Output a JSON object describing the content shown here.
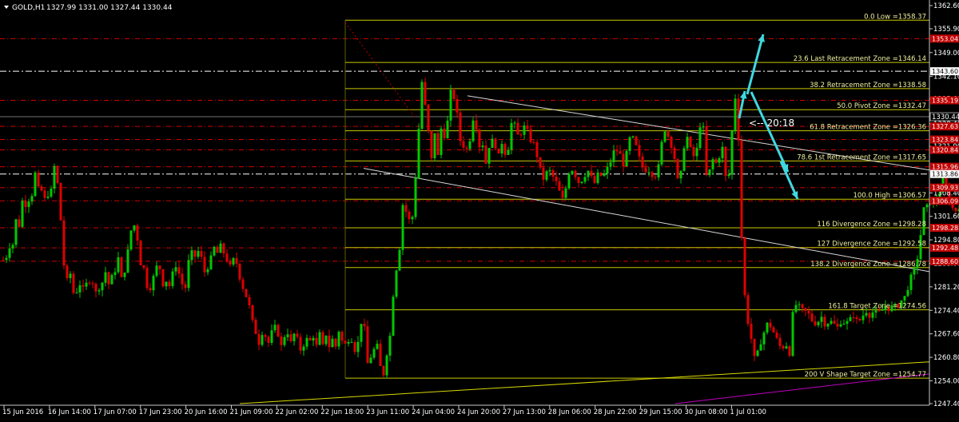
{
  "header": {
    "symbol": "GOLD,H1",
    "ohlc": "1327.99 1331.00 1327.44 1330.44"
  },
  "colors": {
    "background": "#000000",
    "bull": "#00c800",
    "bear": "#e00000",
    "fib": "#c8c800",
    "level": "#d00000",
    "trend": "#d8d8d8",
    "arrow": "#40d8e0",
    "support": "#d8d800",
    "magenta": "#c000c0"
  },
  "chart_data": {
    "type": "candlestick",
    "title": "GOLD,H1",
    "ylim": [
      1247.4,
      1362.6
    ],
    "y_ticks": [
      "1362.60",
      "1355.90",
      "1349.00",
      "1342.10",
      "1335.60",
      "1328.40",
      "1321.90",
      "1315.10",
      "1308.40",
      "1301.60",
      "1294.80",
      "1288.00",
      "1281.20",
      "1274.40",
      "1267.60",
      "1260.80",
      "1254.00",
      "1247.40"
    ],
    "x_ticks": [
      "15 Jun 2016",
      "16 Jun 14:00",
      "17 Jun 07:00",
      "17 Jun 23:00",
      "20 Jun 16:00",
      "21 Jun 09:00",
      "22 Jun 02:00",
      "22 Jun 18:00",
      "23 Jun 11:00",
      "24 Jun 04:00",
      "24 Jun 20:00",
      "27 Jun 13:00",
      "28 Jun 06:00",
      "28 Jun 22:00",
      "29 Jun 15:00",
      "30 Jun 08:00",
      "1 Jul 01:00"
    ],
    "current_price": "1330.44",
    "current_price_value": 1330.44,
    "white_levels": [
      {
        "label": "1343.60",
        "value": 1343.6
      },
      {
        "label": "1313.86",
        "value": 1313.86
      }
    ],
    "red_levels": [
      {
        "label": "1353.04",
        "value": 1353.04
      },
      {
        "label": "1335.19",
        "value": 1335.19
      },
      {
        "label": "1327.63",
        "value": 1327.63
      },
      {
        "label": "1323.84",
        "value": 1323.84
      },
      {
        "label": "1320.84",
        "value": 1320.84
      },
      {
        "label": "1315.96",
        "value": 1315.96
      },
      {
        "label": "1309.93",
        "value": 1309.93
      },
      {
        "label": "1306.09",
        "value": 1306.09
      },
      {
        "label": "1298.28",
        "value": 1298.28
      },
      {
        "label": "1292.48",
        "value": 1292.48
      },
      {
        "label": "1288.60",
        "value": 1288.6
      }
    ],
    "fib_levels": [
      {
        "label": "0.0 Low =1358.37",
        "value": 1358.37
      },
      {
        "label": "23.6 Last Retracement Zone =1346.14",
        "value": 1346.14
      },
      {
        "label": "38.2 Retracement Zone =1338.58",
        "value": 1338.58
      },
      {
        "label": "50.0 Pivot Zone =1332.47",
        "value": 1332.47
      },
      {
        "label": "61.8 Retracement Zone =1326.36",
        "value": 1326.36
      },
      {
        "label": "78.6 1st Retracement Zone =1317.65",
        "value": 1317.65
      },
      {
        "label": "100.0 High =1306.57",
        "value": 1306.57
      },
      {
        "label": "116 Divergence Zone =1298.28",
        "value": 1298.28
      },
      {
        "label": "127 Divergence Zone =1292.58",
        "value": 1292.58
      },
      {
        "label": "138.2 Divergence Zone =1286.78",
        "value": 1286.78
      },
      {
        "label": "161.8 Target Zone =1274.56",
        "value": 1274.56
      },
      {
        "label": "200 V Shape Target Zone =1254.77",
        "value": 1254.77
      }
    ],
    "countdown_text": "<-- 20:18",
    "anchors": [
      [
        1336.5,
        1337
      ],
      [
        1332.0,
        1320
      ],
      [
        1328.5,
        1317
      ],
      [
        1327.0,
        1311
      ],
      [
        1326.5,
        1309
      ],
      [
        1307.0,
        1299
      ],
      [
        1304.0,
        1296
      ],
      [
        1304.5,
        1290
      ],
      [
        1321.0,
        1287
      ],
      [
        1320.5,
        1277
      ],
      [
        1312.0,
        1263
      ],
      [
        1305.0,
        1255
      ],
      [
        1303.0,
        1250
      ],
      [
        1300.5,
        1245
      ],
      [
        1301.8,
        1243
      ],
      [
        1306.5,
        1236
      ],
      [
        1303.5,
        1231
      ],
      [
        1303.0,
        1228
      ],
      [
        1304.0,
        1224
      ],
      [
        1306.0,
        1222
      ],
      [
        1305.5,
        1219
      ],
      [
        1303.0,
        1217
      ],
      [
        1303.2,
        1212
      ],
      [
        1305.5,
        1208
      ],
      [
        1306.2,
        1206
      ],
      [
        1305.0,
        1202
      ],
      [
        1304.5,
        1200
      ],
      [
        1303.0,
        1195
      ],
      [
        1305.0,
        1189
      ],
      [
        1307.5,
        1187
      ],
      [
        1310.0,
        1184
      ],
      [
        1312.5,
        1180
      ],
      [
        1308.0,
        1175
      ],
      [
        1305.0,
        1169
      ],
      [
        1306.5,
        1165
      ],
      [
        1304.5,
        1161
      ],
      [
        1303.5,
        1155
      ],
      [
        1291.5,
        1150
      ],
      [
        1286.0,
        1144
      ],
      [
        1283.5,
        1139
      ],
      [
        1278.5,
        1133
      ],
      [
        1277.0,
        1127
      ],
      [
        1275.0,
        1122
      ],
      [
        1276.0,
        1118
      ],
      [
        1274.5,
        1113
      ],
      [
        1276.0,
        1109
      ],
      [
        1274.5,
        1104
      ],
      [
        1273.5,
        1098
      ],
      [
        1274.0,
        1093
      ],
      [
        1273.0,
        1088
      ],
      [
        1274.5,
        1083
      ],
      [
        1272.0,
        1078
      ],
      [
        1271.0,
        1073
      ],
      [
        1273.0,
        1068
      ],
      [
        1271.5,
        1063
      ],
      [
        1270.5,
        1058
      ],
      [
        1271.5,
        1053
      ],
      [
        1269.5,
        1048
      ],
      [
        1270.5,
        1043
      ],
      [
        1271.5,
        1038
      ],
      [
        1270.0,
        1033
      ],
      [
        1272.5,
        1028
      ],
      [
        1271.0,
        1023
      ],
      [
        1270.5,
        1018
      ],
      [
        1273.0,
        1013
      ],
      [
        1274.0,
        1008
      ],
      [
        1274.5,
        1003
      ],
      [
        1276.0,
        998
      ],
      [
        1276.0,
        993
      ],
      [
        1262.0,
        988
      ],
      [
        1265.0,
        983
      ],
      [
        1263.0,
        978
      ],
      [
        1266.0,
        972
      ],
      [
        1269.0,
        966
      ],
      [
        1271.0,
        961
      ],
      [
        1268.0,
        956
      ],
      [
        1264.0,
        950
      ],
      [
        1259.0,
        945
      ],
      [
        1265.0,
        941
      ],
      [
        1271.0,
        936
      ],
      [
        1280.5,
        931
      ],
      [
        1300.5,
        927
      ],
      [
        1340.0,
        922
      ],
      [
        1330.0,
        917
      ],
      [
        1315.0,
        913
      ],
      [
        1310.0,
        909
      ],
      [
        1322.0,
        905
      ],
      [
        1319.0,
        900
      ],
      [
        1317.0,
        896
      ],
      [
        1318.0,
        892
      ],
      [
        1314.0,
        887
      ],
      [
        1313.0,
        883
      ],
      [
        1327.0,
        880
      ],
      [
        1328.0,
        876
      ],
      [
        1321.0,
        872
      ],
      [
        1319.0,
        868
      ],
      [
        1321.0,
        864
      ],
      [
        1324.5,
        860
      ],
      [
        1322.0,
        856
      ],
      [
        1314.0,
        852
      ],
      [
        1312.0,
        848
      ],
      [
        1320.0,
        843
      ],
      [
        1323.0,
        839
      ],
      [
        1326.0,
        834
      ],
      [
        1327.5,
        830
      ],
      [
        1318.0,
        826
      ],
      [
        1314.0,
        822
      ],
      [
        1313.0,
        818
      ],
      [
        1315.0,
        813
      ],
      [
        1315.0,
        808
      ],
      [
        1316.0,
        803
      ],
      [
        1320.0,
        798
      ],
      [
        1323.5,
        794
      ],
      [
        1325.0,
        789
      ],
      [
        1321.0,
        785
      ],
      [
        1316.0,
        781
      ],
      [
        1319.0,
        777
      ],
      [
        1320.5,
        773
      ],
      [
        1321.0,
        769
      ],
      [
        1318.0,
        765
      ],
      [
        1316.0,
        761
      ],
      [
        1314.0,
        757
      ],
      [
        1313.0,
        753
      ],
      [
        1314.5,
        749
      ],
      [
        1311.0,
        745
      ],
      [
        1312.0,
        741
      ],
      [
        1315.0,
        737
      ],
      [
        1314.0,
        733
      ],
      [
        1312.5,
        729
      ],
      [
        1311.0,
        725
      ],
      [
        1313.0,
        721
      ],
      [
        1315.0,
        717
      ],
      [
        1315.5,
        713
      ],
      [
        1311.0,
        709
      ],
      [
        1306.0,
        705
      ],
      [
        1308.0,
        701
      ],
      [
        1311.0,
        697
      ],
      [
        1312.5,
        693
      ],
      [
        1314.5,
        689
      ],
      [
        1315.0,
        685
      ],
      [
        1312.0,
        681
      ],
      [
        1314.0,
        677
      ],
      [
        1318.0,
        673
      ],
      [
        1322.5,
        669
      ],
      [
        1323.0,
        665
      ],
      [
        1325.5,
        661
      ],
      [
        1328.0,
        657
      ],
      [
        1326.0,
        653
      ],
      [
        1325.0,
        648
      ],
      [
        1328.0,
        644
      ],
      [
        1328.5,
        640
      ],
      [
        1321.5,
        636
      ],
      [
        1320.0,
        632
      ],
      [
        1323.0,
        628
      ],
      [
        1319.0,
        624
      ],
      [
        1322.0,
        620
      ],
      [
        1323.5,
        616
      ],
      [
        1322.0,
        612
      ],
      [
        1317.0,
        608
      ],
      [
        1322.5,
        604
      ],
      [
        1322.0,
        600
      ],
      [
        1327.5,
        596
      ],
      [
        1330.0,
        592
      ],
      [
        1324.0,
        588
      ],
      [
        1321.0,
        584
      ],
      [
        1322.0,
        580
      ],
      [
        1323.5,
        576
      ],
      [
        1331.0,
        572
      ],
      [
        1336.0,
        568
      ],
      [
        1337.5,
        564
      ],
      [
        1329.0,
        560
      ],
      [
        1325.0,
        556
      ],
      [
        1327.0,
        552
      ],
      [
        1319.0,
        548
      ],
      [
        1326.0,
        544
      ],
      [
        1318.0,
        540
      ],
      [
        1326.0,
        536
      ],
      [
        1333.5,
        532
      ],
      [
        1340.5,
        528
      ],
      [
        1327.0,
        524
      ],
      [
        1313.0,
        520
      ],
      [
        1301.5,
        516
      ],
      [
        1300.5,
        512
      ],
      [
        1303.0,
        508
      ],
      [
        1305.0,
        504
      ],
      [
        1292.5,
        500
      ],
      [
        1286.5,
        496
      ],
      [
        1279.0,
        492
      ],
      [
        1267.0,
        488
      ],
      [
        1262.0,
        484
      ],
      [
        1256.0,
        480
      ],
      [
        1258.0,
        476
      ],
      [
        1264.0,
        472
      ],
      [
        1263.0,
        468
      ],
      [
        1261.0,
        464
      ],
      [
        1259.0,
        460
      ],
      [
        1269.0,
        456
      ],
      [
        1271.0,
        452
      ],
      [
        1265.0,
        448
      ],
      [
        1263.0,
        444
      ],
      [
        1266.0,
        440
      ],
      [
        1266.0,
        436
      ],
      [
        1264.5,
        432
      ],
      [
        1265.5,
        428
      ],
      [
        1268.5,
        424
      ],
      [
        1264.0,
        420
      ],
      [
        1266.0,
        416
      ],
      [
        1264.0,
        412
      ],
      [
        1267.5,
        408
      ],
      [
        1264.0,
        404
      ],
      [
        1267.5,
        400
      ],
      [
        1264.0,
        396
      ],
      [
        1267.0,
        392
      ],
      [
        1265.5,
        388
      ],
      [
        1266.0,
        384
      ],
      [
        1264.5,
        380
      ],
      [
        1263.0,
        376
      ],
      [
        1266.0,
        372
      ],
      [
        1267.5,
        368
      ],
      [
        1265.0,
        364
      ],
      [
        1268.0,
        360
      ],
      [
        1267.0,
        356
      ],
      [
        1264.0,
        352
      ],
      [
        1267.5,
        348
      ],
      [
        1269.5,
        344
      ],
      [
        1268.0,
        340
      ],
      [
        1265.0,
        336
      ],
      [
        1267.0,
        332
      ],
      [
        1268.0,
        328
      ],
      [
        1265.0,
        324
      ],
      [
        1268.0,
        320
      ],
      [
        1271.0,
        316
      ],
      [
        1275.5,
        312
      ],
      [
        1278.5,
        308
      ],
      [
        1281.0,
        304
      ],
      [
        1284.0,
        300
      ],
      [
        1288.0,
        296
      ],
      [
        1289.0,
        292
      ],
      [
        1287.0,
        288
      ],
      [
        1289.0,
        284
      ],
      [
        1291.0,
        280
      ],
      [
        1293.0,
        276
      ],
      [
        1291.0,
        272
      ],
      [
        1292.5,
        268
      ],
      [
        1289.5,
        264
      ],
      [
        1287.0,
        260
      ],
      [
        1285.5,
        256
      ],
      [
        1289.5,
        252
      ],
      [
        1291.5,
        248
      ],
      [
        1290.0,
        244
      ],
      [
        1291.0,
        240
      ],
      [
        1288.5,
        236
      ],
      [
        1281.0,
        232
      ],
      [
        1282.0,
        228
      ],
      [
        1285.0,
        224
      ],
      [
        1287.5,
        220
      ],
      [
        1285.0,
        216
      ],
      [
        1281.5,
        212
      ],
      [
        1283.0,
        208
      ],
      [
        1282.0,
        204
      ],
      [
        1286.5,
        200
      ],
      [
        1287.0,
        196
      ],
      [
        1284.0,
        192
      ],
      [
        1281.0,
        188
      ],
      [
        1281.5,
        184
      ],
      [
        1286.5,
        180
      ],
      [
        1288.0,
        176
      ],
      [
        1295.0,
        172
      ],
      [
        1299.0,
        168
      ],
      [
        1297.5,
        164
      ],
      [
        1291.5,
        160
      ],
      [
        1286.0,
        156
      ],
      [
        1283.5,
        152
      ],
      [
        1289.5,
        148
      ],
      [
        1286.0,
        144
      ],
      [
        1284.0,
        140
      ],
      [
        1282.0,
        136
      ],
      [
        1285.5,
        132
      ],
      [
        1282.5,
        128
      ],
      [
        1281.0,
        124
      ],
      [
        1279.5,
        120
      ],
      [
        1282.5,
        116
      ],
      [
        1283.0,
        112
      ],
      [
        1282.0,
        108
      ],
      [
        1280.5,
        104
      ],
      [
        1282.0,
        100
      ],
      [
        1280.0,
        96
      ],
      [
        1279.5,
        92
      ],
      [
        1285.0,
        88
      ],
      [
        1283.0,
        84
      ],
      [
        1287.5,
        80
      ],
      [
        1300.5,
        76
      ],
      [
        1311.0,
        72
      ],
      [
        1316.0,
        68
      ],
      [
        1309.0,
        64
      ],
      [
        1308.0,
        60
      ],
      [
        1306.5,
        56
      ],
      [
        1309.0,
        52
      ],
      [
        1309.5,
        48
      ],
      [
        1314.0,
        44
      ],
      [
        1308.0,
        40
      ],
      [
        1306.5,
        36
      ],
      [
        1305.0,
        32
      ],
      [
        1306.0,
        28
      ],
      [
        1299.0,
        24
      ],
      [
        1300.5,
        20
      ],
      [
        1293.5,
        16
      ],
      [
        1293.0,
        12
      ],
      [
        1290.0,
        8
      ],
      [
        1289.0,
        4
      ]
    ]
  }
}
